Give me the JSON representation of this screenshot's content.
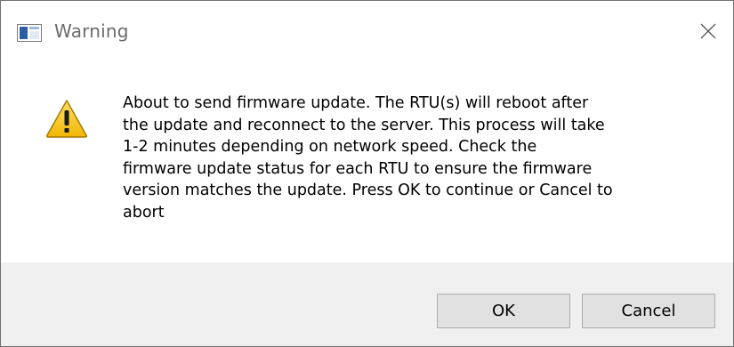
{
  "window": {
    "title": "Warning",
    "close_icon": "close-icon",
    "app_icon": "window-app-icon"
  },
  "dialog": {
    "icon": "warning-icon",
    "message": "About to send firmware update. The RTU(s) will reboot after\nthe update and reconnect to the server. This process will take\n1-2 minutes depending on network speed. Check the\nfirmware update status for each RTU to ensure the firmware\nversion matches the update. Press OK to continue or Cancel to\nabort"
  },
  "buttons": {
    "ok_label": "OK",
    "cancel_label": "Cancel"
  },
  "colors": {
    "footer_bg": "#f0f0f0",
    "button_bg": "#e1e1e1",
    "button_border": "#adadad",
    "warning_yellow": "#f5c518",
    "title_text": "#6b6b6b"
  }
}
